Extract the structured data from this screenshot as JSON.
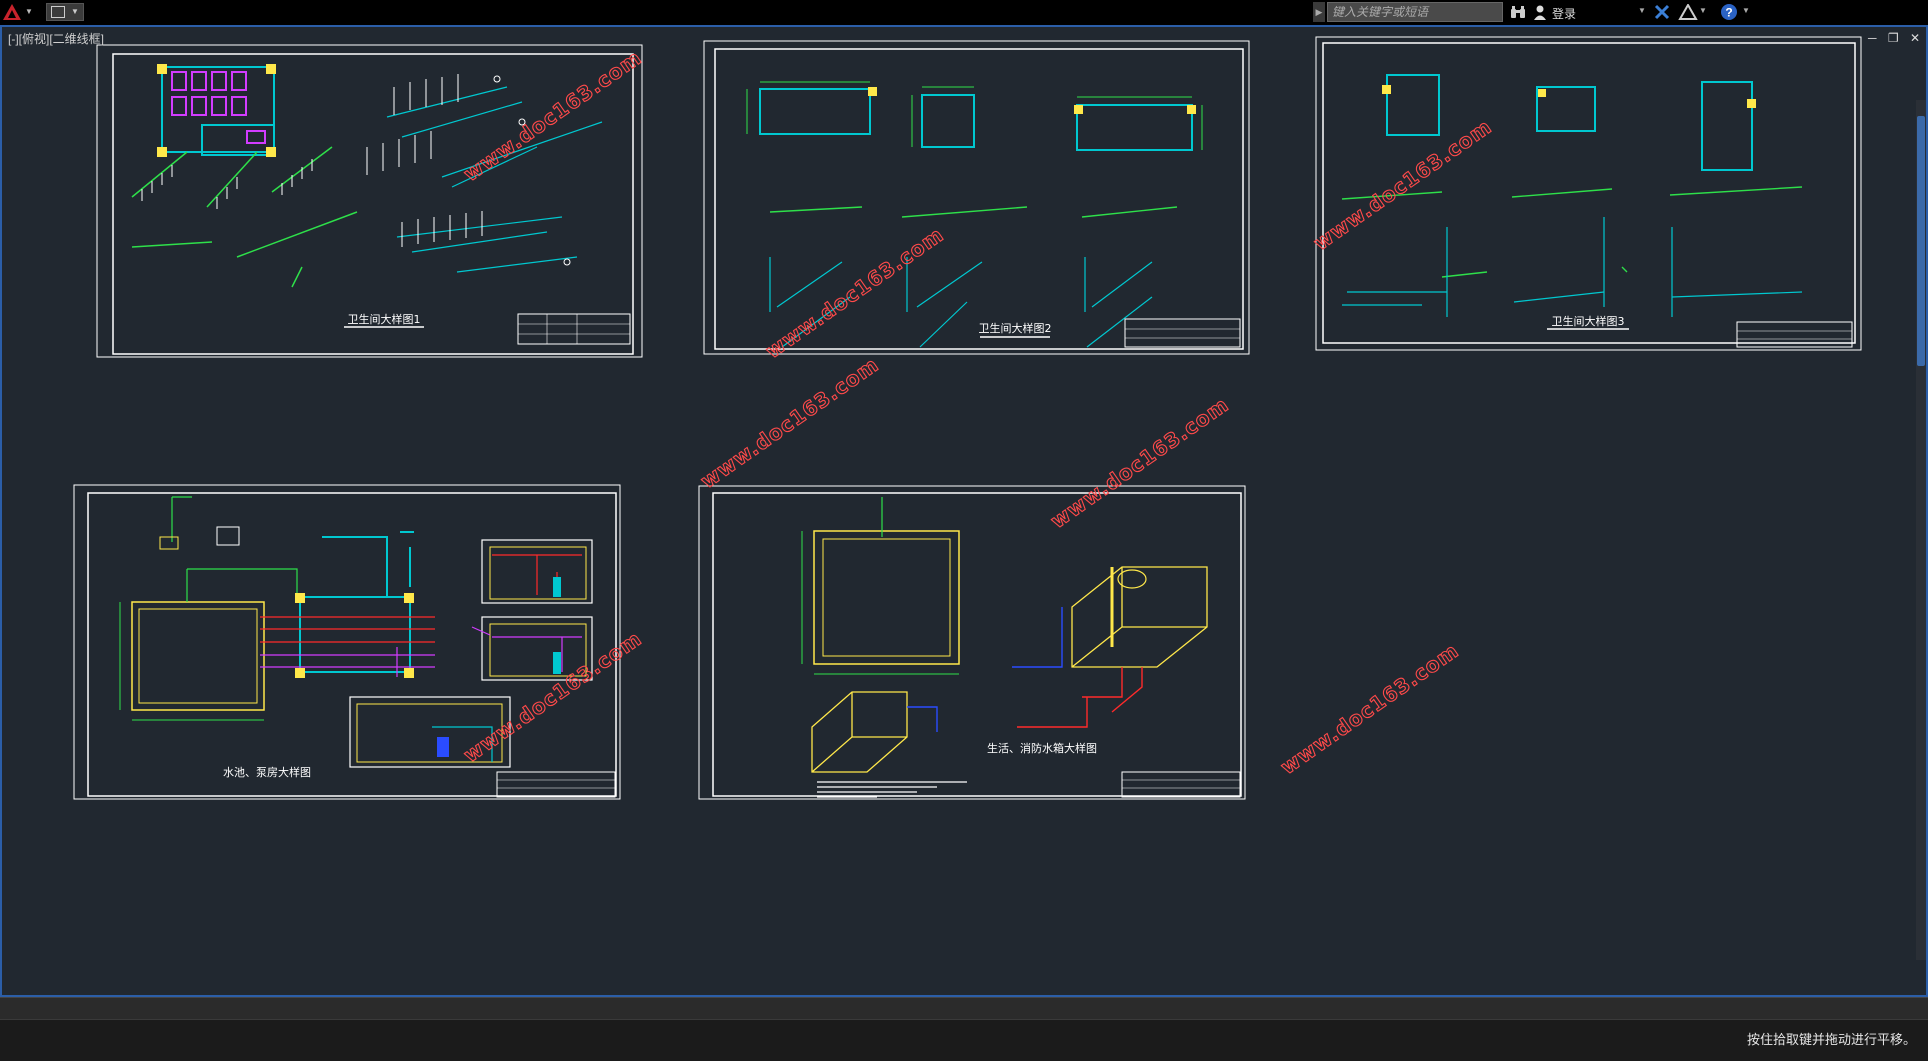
{
  "titlebar": {
    "search_placeholder": "键入关键字或短语",
    "login_label": "登录",
    "colors": {
      "background": "#000000",
      "logo_red": "#c8232c",
      "exchange_blue": "#3b7fd6"
    }
  },
  "viewport": {
    "label": "[-][俯视][二维线框]",
    "minimize_glyph": "─",
    "restore_glyph": "❐",
    "close_glyph": "✕"
  },
  "drawings": {
    "sheet1_title": "卫生间大样图1",
    "sheet2_title": "卫生间大样图2",
    "sheet3_title": "卫生间大样图3",
    "sheet4_title": "水池、泵房大样图",
    "sheet5_title": "生活、消防水箱大样图"
  },
  "watermarks": {
    "text": "www.doc163.com",
    "color": "#ff4a4a"
  },
  "status": {
    "message": "按住拾取键并拖动进行平移。"
  },
  "colors": {
    "canvas_bg": "#212830",
    "cyan_pipe": "#00c8d0",
    "green_pipe": "#2ee04a",
    "white_line": "#ffffff",
    "yellow_wall": "#ffe84a",
    "magenta_fixture": "#d23cff",
    "red_pipe": "#ff2a2a"
  }
}
